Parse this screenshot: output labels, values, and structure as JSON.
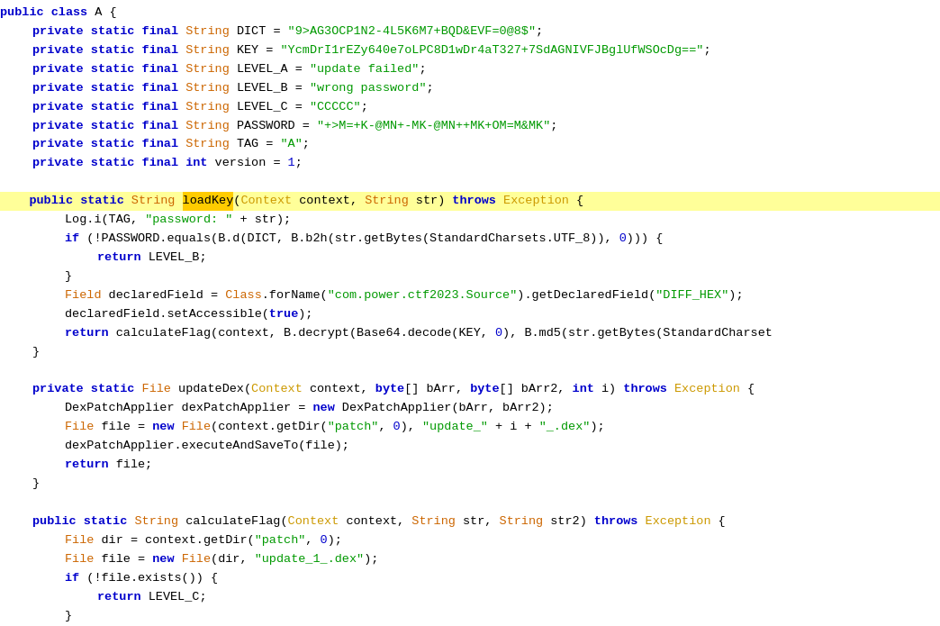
{
  "code": {
    "lines": [
      {
        "id": 1,
        "indent": 0,
        "highlighted": false,
        "content": "public class A {"
      },
      {
        "id": 2,
        "indent": 1,
        "highlighted": false,
        "content": "    private static final String DICT = \"9>AG3OCP1N2-4L5K6M7+BQD&EVF=0@8$\";"
      },
      {
        "id": 3,
        "indent": 1,
        "highlighted": false,
        "content": "    private static final String KEY = \"YcmDrI1rEZy640e7oLPC8D1wDr4aT327+7SdAGNIVFJBglUfWSOcDg==\";"
      },
      {
        "id": 4,
        "indent": 1,
        "highlighted": false,
        "content": "    private static final String LEVEL_A = \"update failed\";"
      },
      {
        "id": 5,
        "indent": 1,
        "highlighted": false,
        "content": "    private static final String LEVEL_B = \"wrong password\";"
      },
      {
        "id": 6,
        "indent": 1,
        "highlighted": false,
        "content": "    private static final String LEVEL_C = \"CCCCC\";"
      },
      {
        "id": 7,
        "indent": 1,
        "highlighted": false,
        "content": "    private static final String PASSWORD = \"+>M=+K-@MN+-MK-@MN++MK+OM=M&MK\";"
      },
      {
        "id": 8,
        "indent": 1,
        "highlighted": false,
        "content": "    private static final String TAG = \"A\";"
      },
      {
        "id": 9,
        "indent": 1,
        "highlighted": false,
        "content": "    private static final int version = 1;"
      },
      {
        "id": 10,
        "indent": 0,
        "highlighted": false,
        "content": ""
      },
      {
        "id": 11,
        "indent": 0,
        "highlighted": true,
        "content": "    public static String loadKey(Context context, String str) throws Exception {"
      },
      {
        "id": 12,
        "indent": 2,
        "highlighted": false,
        "content": "        Log.i(TAG, \"password: \" + str);"
      },
      {
        "id": 13,
        "indent": 2,
        "highlighted": false,
        "content": "        if (!PASSWORD.equals(B.d(DICT, B.b2h(str.getBytes(StandardCharsets.UTF_8)), 0))) {"
      },
      {
        "id": 14,
        "indent": 3,
        "highlighted": false,
        "content": "            return LEVEL_B;"
      },
      {
        "id": 15,
        "indent": 2,
        "highlighted": false,
        "content": "        }"
      },
      {
        "id": 16,
        "indent": 2,
        "highlighted": false,
        "content": "        Field declaredField = Class.forName(\"com.power.ctf2023.Source\").getDeclaredField(\"DIFF_HEX\");"
      },
      {
        "id": 17,
        "indent": 2,
        "highlighted": false,
        "content": "        declaredField.setAccessible(true);"
      },
      {
        "id": 18,
        "indent": 2,
        "highlighted": false,
        "content": "        return calculateFlag(context, B.decrypt(Base64.decode(KEY, 0), B.md5(str.getBytes(StandardCharset"
      },
      {
        "id": 19,
        "indent": 0,
        "highlighted": false,
        "content": "    }"
      },
      {
        "id": 20,
        "indent": 0,
        "highlighted": false,
        "content": ""
      },
      {
        "id": 21,
        "indent": 1,
        "highlighted": false,
        "content": "    private static File updateDex(Context context, byte[] bArr, byte[] bArr2, int i) throws Exception {"
      },
      {
        "id": 22,
        "indent": 2,
        "highlighted": false,
        "content": "        DexPatchApplier dexPatchApplier = new DexPatchApplier(bArr, bArr2);"
      },
      {
        "id": 23,
        "indent": 2,
        "highlighted": false,
        "content": "        File file = new File(context.getDir(\"patch\", 0), \"update_\" + i + \"_.dex\");"
      },
      {
        "id": 24,
        "indent": 2,
        "highlighted": false,
        "content": "        dexPatchApplier.executeAndSaveTo(file);"
      },
      {
        "id": 25,
        "indent": 2,
        "highlighted": false,
        "content": "        return file;"
      },
      {
        "id": 26,
        "indent": 1,
        "highlighted": false,
        "content": "    }"
      },
      {
        "id": 27,
        "indent": 0,
        "highlighted": false,
        "content": ""
      },
      {
        "id": 28,
        "indent": 1,
        "highlighted": false,
        "content": "    public static String calculateFlag(Context context, String str, String str2) throws Exception {"
      },
      {
        "id": 29,
        "indent": 2,
        "highlighted": false,
        "content": "        File dir = context.getDir(\"patch\", 0);"
      },
      {
        "id": 30,
        "indent": 2,
        "highlighted": false,
        "content": "        File file = new File(dir, \"update_1_.dex\");"
      },
      {
        "id": 31,
        "indent": 2,
        "highlighted": false,
        "content": "        if (!file.exists()) {"
      },
      {
        "id": 32,
        "indent": 3,
        "highlighted": false,
        "content": "            return LEVEL_C;"
      },
      {
        "id": 33,
        "indent": 2,
        "highlighted": false,
        "content": "        }"
      }
    ]
  }
}
